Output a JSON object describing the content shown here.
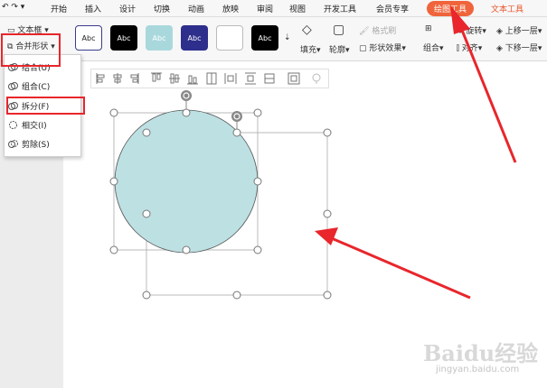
{
  "menubar": {
    "items": [
      "开始",
      "插入",
      "设计",
      "切换",
      "动画",
      "放映",
      "审阅",
      "视图",
      "开发工具",
      "会员专享",
      "绘图工具",
      "文本工具"
    ]
  },
  "ribbon": {
    "text_box": "文本框",
    "merge_shapes": "合并形状",
    "style_swatches": [
      "Abc",
      "Abc",
      "Abc",
      "Abc",
      "",
      "Abc"
    ],
    "fill": "填充",
    "outline": "轮廓",
    "format_painter": "格式刷",
    "shape_effects": "形状效果",
    "group": "组合",
    "rotate": "旋转",
    "align": "对齐",
    "bring_forward": "上移一层",
    "send_backward": "下移一层"
  },
  "dropdown": {
    "items": [
      "结合(U)",
      "组合(C)",
      "拆分(F)",
      "相交(I)",
      "剪除(S)"
    ]
  },
  "colors": {
    "accent": "#e8262b",
    "tab_active": "#f0643c",
    "circle_fill": "#bde0e3",
    "text_tool": "#e8552b"
  },
  "watermark": {
    "logo": "Baidu经验",
    "url": "jingyan.baidu.com"
  }
}
